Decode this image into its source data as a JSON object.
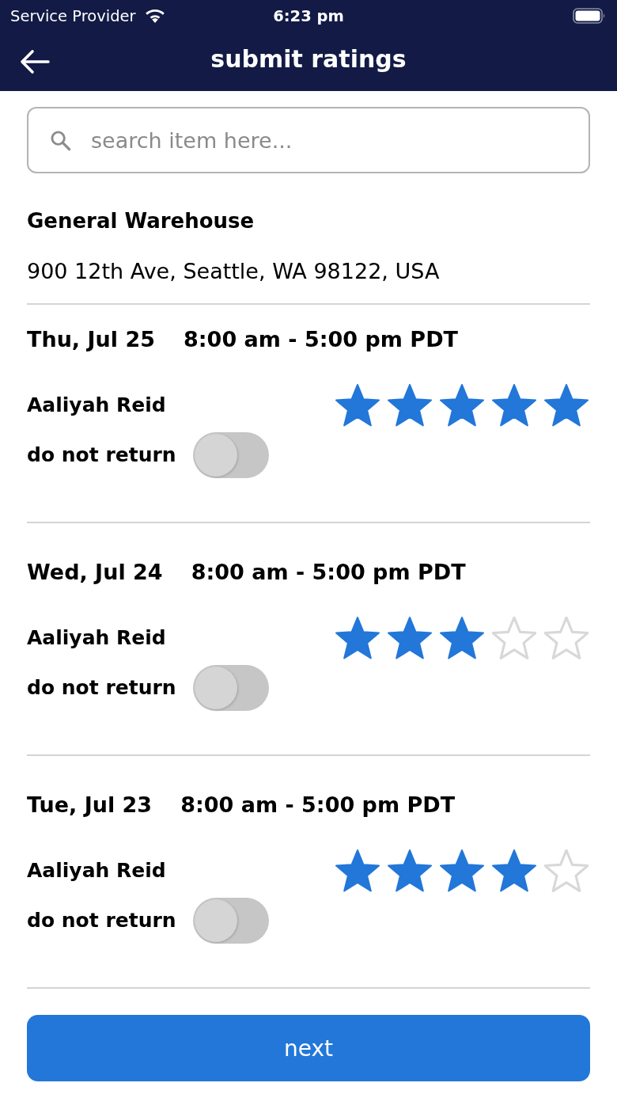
{
  "status_bar": {
    "carrier": "Service Provider",
    "time": "6:23 pm"
  },
  "header": {
    "title": "submit ratings"
  },
  "search": {
    "placeholder": "search item here..."
  },
  "location": {
    "name": "General Warehouse",
    "address": "900 12th Ave, Seattle, WA 98122, USA"
  },
  "shifts": [
    {
      "date": "Thu, Jul 25",
      "time": "8:00 am - 5:00 pm PDT",
      "worker": "Aaliyah Reid",
      "stars": 5,
      "toggle_label": "do not return",
      "do_not_return": false
    },
    {
      "date": "Wed, Jul 24",
      "time": "8:00 am - 5:00 pm PDT",
      "worker": "Aaliyah Reid",
      "stars": 3,
      "toggle_label": "do not return",
      "do_not_return": false
    },
    {
      "date": "Tue, Jul 23",
      "time": "8:00 am - 5:00 pm PDT",
      "worker": "Aaliyah Reid",
      "stars": 4,
      "toggle_label": "do not return",
      "do_not_return": false
    }
  ],
  "next_button": {
    "label": "next"
  }
}
